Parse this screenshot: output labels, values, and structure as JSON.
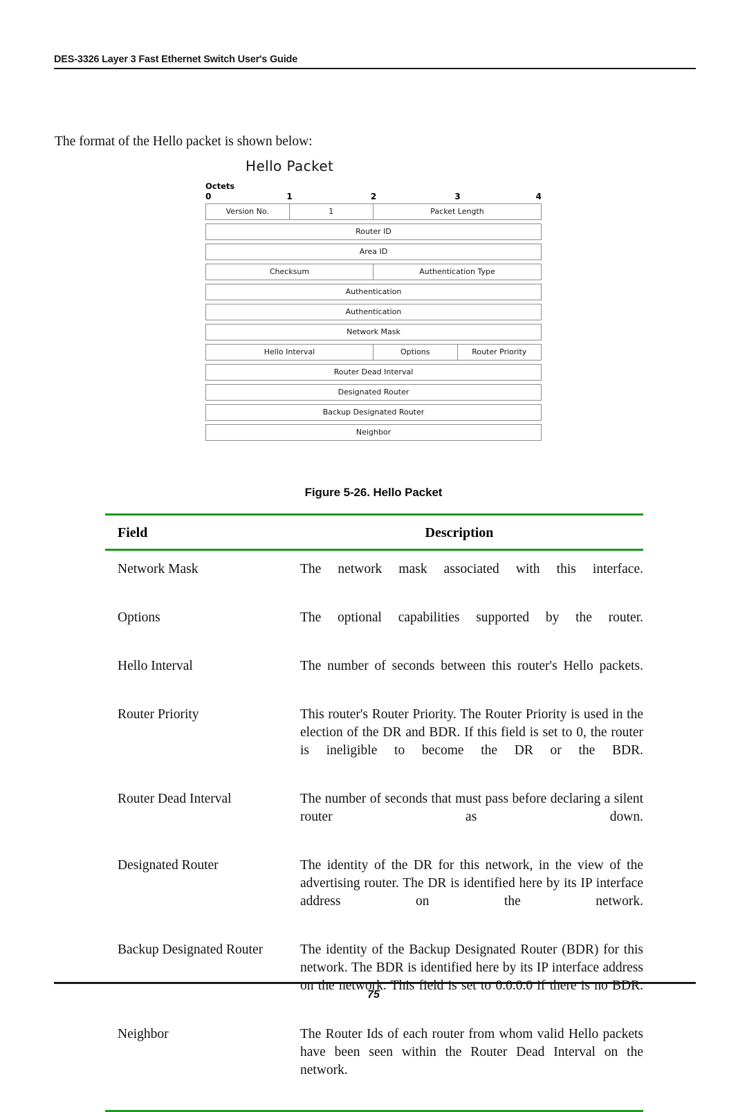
{
  "header": {
    "title": "DES-3326 Layer 3 Fast Ethernet Switch User's Guide"
  },
  "intro": {
    "text": "The format of the Hello packet is shown below:"
  },
  "diagram": {
    "title": "Hello Packet",
    "octets_label": "Octets",
    "ruler_ticks": [
      "0",
      "1",
      "2",
      "3",
      "4"
    ],
    "rows": [
      {
        "cells": [
          {
            "label": "Version No.",
            "octets": 1
          },
          {
            "label": "1",
            "octets": 1
          },
          {
            "label": "Packet Length",
            "octets": 2
          }
        ]
      },
      {
        "cells": [
          {
            "label": "Router ID",
            "octets": 4
          }
        ]
      },
      {
        "cells": [
          {
            "label": "Area ID",
            "octets": 4
          }
        ]
      },
      {
        "cells": [
          {
            "label": "Checksum",
            "octets": 2
          },
          {
            "label": "Authentication Type",
            "octets": 2
          }
        ]
      },
      {
        "cells": [
          {
            "label": "Authentication",
            "octets": 4
          }
        ]
      },
      {
        "cells": [
          {
            "label": "Authentication",
            "octets": 4
          }
        ]
      },
      {
        "cells": [
          {
            "label": "Network Mask",
            "octets": 4
          }
        ]
      },
      {
        "cells": [
          {
            "label": "Hello Interval",
            "octets": 2
          },
          {
            "label": "Options",
            "octets": 1
          },
          {
            "label": "Router Priority",
            "octets": 1
          }
        ]
      },
      {
        "cells": [
          {
            "label": "Router Dead Interval",
            "octets": 4
          }
        ]
      },
      {
        "cells": [
          {
            "label": "Designated Router",
            "octets": 4
          }
        ]
      },
      {
        "cells": [
          {
            "label": "Backup Designated Router",
            "octets": 4
          }
        ]
      },
      {
        "cells": [
          {
            "label": "Neighbor",
            "octets": 4
          }
        ]
      }
    ]
  },
  "figure_caption": "Figure 5-26.  Hello Packet",
  "table": {
    "headers": {
      "field": "Field",
      "description": "Description"
    },
    "rows": [
      {
        "field": "Network Mask",
        "description": "The network mask associated with this interface."
      },
      {
        "field": "Options",
        "description": "The optional capabilities supported by the router."
      },
      {
        "field": "Hello Interval",
        "description": "The number of seconds between this router's Hello packets."
      },
      {
        "field": "Router Priority",
        "description": "This router's Router Priority.  The Router Priority is used in the election of the DR and BDR. If this field is set to 0, the router is ineligible to become the DR or the BDR."
      },
      {
        "field": "Router Dead Interval",
        "description": "The number of seconds that must pass before declaring a silent router as down."
      },
      {
        "field": "Designated Router",
        "description": "The identity of the DR for this network, in the view of the advertising router. The DR is identified here by its IP interface address on the network."
      },
      {
        "field": "Backup Designated Router",
        "description": "The identity of the Backup Designated Router (BDR) for this network. The BDR is identified here by its IP interface address on the network. This field is set to 0.0.0.0 if there is no BDR."
      },
      {
        "field": "Neighbor",
        "description": "The Router Ids of each router from whom valid Hello packets have been seen within the Router Dead Interval on the network."
      }
    ]
  },
  "footer": {
    "page_number": "75"
  },
  "colors": {
    "rule_green": "#1a9a1a",
    "rule_dark": "#1a1a1a",
    "box_border": "#8c8c8c"
  }
}
